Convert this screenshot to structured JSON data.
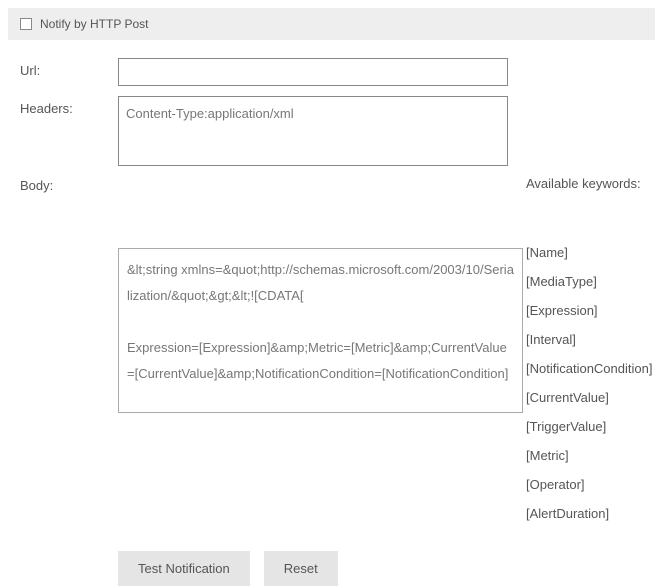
{
  "header": {
    "checkbox_label": "Notify by HTTP Post",
    "checked": false
  },
  "form": {
    "url_label": "Url:",
    "url_value": "",
    "headers_label": "Headers:",
    "headers_value": "Content-Type:application/xml",
    "body_label": "Body:",
    "body_value": "&lt;string xmlns=&quot;http://schemas.microsoft.com/2003/10/Serialization/&quot;&gt;&lt;![CDATA[\n\nExpression=[Expression]&amp;Metric=[Metric]&amp;CurrentValue=[CurrentValue]&amp;NotificationCondition=[NotificationCondition]"
  },
  "keywords": {
    "title": "Available keywords:",
    "items": [
      "[Name]",
      "[MediaType]",
      "[Expression]",
      "[Interval]",
      "[NotificationCondition]",
      "[CurrentValue]",
      "[TriggerValue]",
      "[Metric]",
      "[Operator]",
      "[AlertDuration]"
    ]
  },
  "buttons": {
    "test_label": "Test Notification",
    "reset_label": "Reset"
  }
}
